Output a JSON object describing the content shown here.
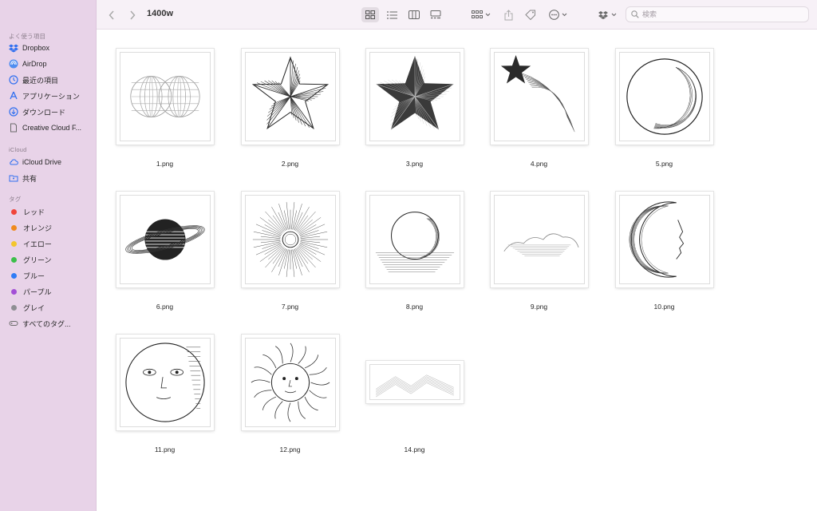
{
  "window": {
    "title": "1400w"
  },
  "toolbar": {
    "back_icon": "chevron-left-icon",
    "forward_icon": "chevron-right-icon",
    "views": [
      "icon-view",
      "list-view",
      "column-view",
      "gallery-view"
    ],
    "selected_view": "icon-view",
    "search_placeholder": "検索"
  },
  "sidebar": {
    "favorites_header": "よく使う項目",
    "favorites": [
      {
        "label": "Dropbox",
        "icon": "dropbox-icon"
      },
      {
        "label": "AirDrop",
        "icon": "airdrop-icon"
      },
      {
        "label": "最近の項目",
        "icon": "clock-icon"
      },
      {
        "label": "アプリケーション",
        "icon": "applications-icon"
      },
      {
        "label": "ダウンロード",
        "icon": "download-icon"
      },
      {
        "label": "Creative Cloud F...",
        "icon": "document-icon"
      }
    ],
    "icloud_header": "iCloud",
    "icloud": [
      {
        "label": "iCloud Drive",
        "icon": "cloud-icon"
      },
      {
        "label": "共有",
        "icon": "shared-folder-icon"
      }
    ],
    "tags_header": "タグ",
    "tags": [
      {
        "label": "レッド",
        "color": "#f0453a"
      },
      {
        "label": "オレンジ",
        "color": "#f08a1d"
      },
      {
        "label": "イエロー",
        "color": "#f3c62d"
      },
      {
        "label": "グリーン",
        "color": "#3cbf4a"
      },
      {
        "label": "ブルー",
        "color": "#2f7cf6"
      },
      {
        "label": "パープル",
        "color": "#a34fd6"
      },
      {
        "label": "グレイ",
        "color": "#8e8e93"
      }
    ],
    "all_tags": "すべてのタグ..."
  },
  "files": [
    {
      "name": "1.png",
      "art": "globes"
    },
    {
      "name": "2.png",
      "art": "star-outline"
    },
    {
      "name": "3.png",
      "art": "star-dark"
    },
    {
      "name": "4.png",
      "art": "shooting-star"
    },
    {
      "name": "5.png",
      "art": "circle"
    },
    {
      "name": "6.png",
      "art": "saturn"
    },
    {
      "name": "7.png",
      "art": "sunburst"
    },
    {
      "name": "8.png",
      "art": "rising-sun"
    },
    {
      "name": "9.png",
      "art": "clouds"
    },
    {
      "name": "10.png",
      "art": "crescent-moon"
    },
    {
      "name": "11.png",
      "art": "moon-face"
    },
    {
      "name": "12.png",
      "art": "sun-face"
    },
    {
      "name": "14.png",
      "art": "mountains"
    }
  ]
}
